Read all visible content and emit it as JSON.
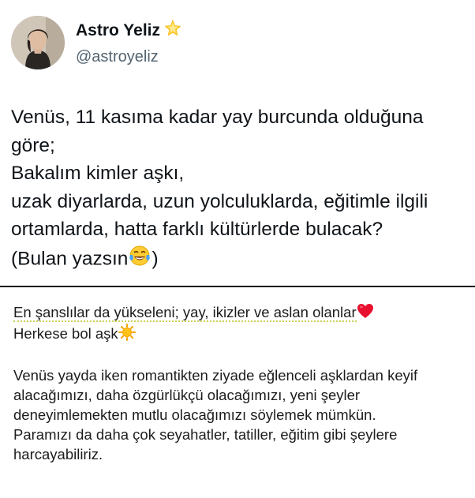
{
  "profile": {
    "display_name": "Astro Yeliz",
    "handle": "@astroyeliz"
  },
  "tweet": {
    "lines": [
      "Venüs, 11 kasıma kadar yay burcunda olduğuna",
      "göre;",
      "Bakalım kimler aşkı,",
      "uzak diyarlarda, uzun yolculuklarda, eğitimle ilgili",
      "ortamlarda, hatta farklı kültürlerde bulacak?"
    ],
    "last_line_prefix": "(Bulan yazsın",
    "last_line_suffix": ")"
  },
  "note": {
    "line1": "En şanslılar da yükseleni; yay, ikizler ve aslan olanlar",
    "line2": "Herkese bol aşk",
    "paragraph": [
      "Venüs yayda iken romantikten ziyade eğlenceli aşklardan keyif",
      "alacağımızı, daha özgürlükçü olacağımızı, yeni şeyler",
      "deneyimlemekten mutlu olacağımızı söylemek mümkün.",
      "Paramızı da daha çok seyahatler, tatiller, eğitim gibi şeylere",
      "harcayabiliriz."
    ]
  },
  "icons": {
    "verified": "star-icon",
    "laughing": "laughing-tears-emoji-icon",
    "heart": "red-heart-emoji-icon",
    "sun": "sun-emoji-icon"
  }
}
